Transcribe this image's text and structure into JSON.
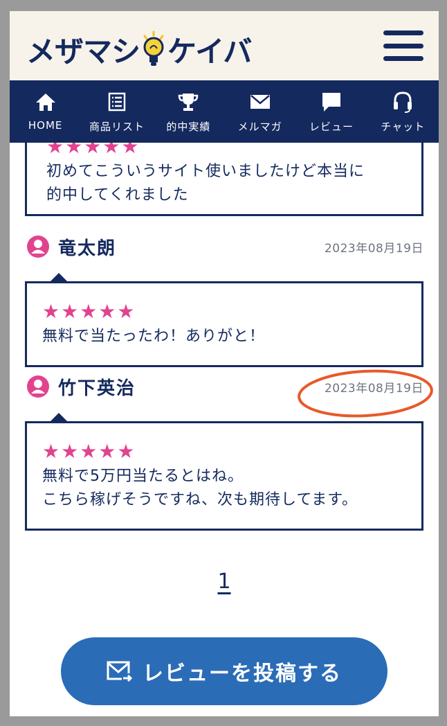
{
  "header": {
    "logo_left": "メザマシ",
    "logo_right": "ケイバ"
  },
  "nav": [
    {
      "label": "HOME",
      "icon": "home-icon"
    },
    {
      "label": "商品リスト",
      "icon": "list-icon"
    },
    {
      "label": "的中実績",
      "icon": "trophy-icon"
    },
    {
      "label": "メルマガ",
      "icon": "mail-icon"
    },
    {
      "label": "レビュー",
      "icon": "speech-bubble-icon"
    },
    {
      "label": "チャット",
      "icon": "headset-icon"
    }
  ],
  "reviews": [
    {
      "stars": "★★★★★",
      "text_lines": [
        "初めてこういうサイト使いましたけど本当に",
        "的中してくれました"
      ]
    },
    {
      "name": "竜太朗",
      "date": "2023年08月19日",
      "stars": "★★★★★",
      "text_lines": [
        "無料で当たったわ！ありがと！"
      ]
    },
    {
      "name": "竹下英治",
      "date": "2023年08月19日",
      "stars": "★★★★★",
      "text_lines": [
        "無料で5万円当たるとはね。",
        "こちら稼げそうですね、次も期待してます。"
      ]
    }
  ],
  "pagination": {
    "current": "1"
  },
  "post_button": {
    "label": "レビューを投稿する",
    "icon": "mail-send-icon"
  },
  "colors": {
    "navy": "#14295e",
    "star_pink": "#e2438f",
    "button_blue": "#2b6cb7",
    "annotation_red": "#e8592a",
    "header_bg": "#f7f3ea"
  }
}
